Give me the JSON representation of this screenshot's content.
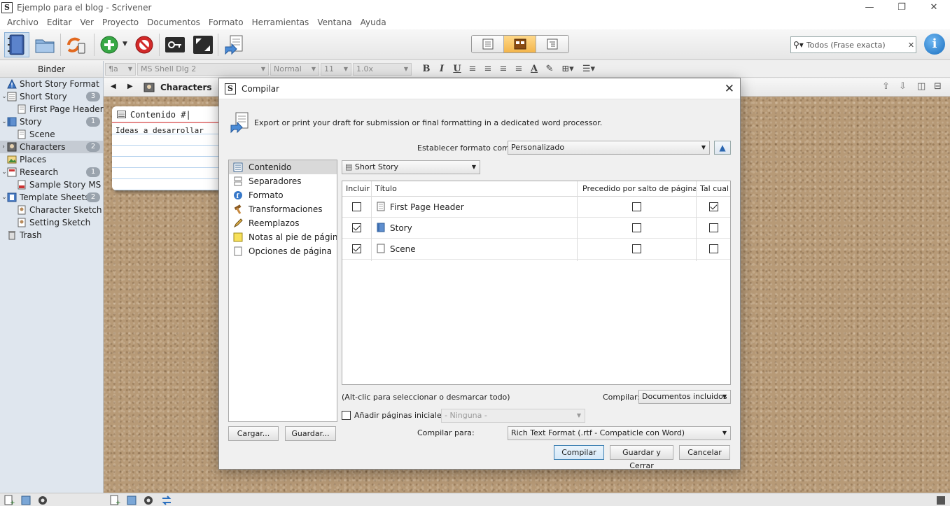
{
  "window": {
    "title": "Ejemplo para el blog - Scrivener",
    "minimize": "—",
    "maximize": "❐",
    "close": "✕"
  },
  "menu": [
    "Archivo",
    "Editar",
    "Ver",
    "Proyecto",
    "Documentos",
    "Formato",
    "Herramientas",
    "Ventana",
    "Ayuda"
  ],
  "search": {
    "value": "Todos (Frase exacta)",
    "clear": "✕"
  },
  "info_label": "i",
  "format_bar": {
    "style": "¶a",
    "font": "MS Shell Dlg 2",
    "weight": "Normal",
    "size": "11",
    "spacing": "1.0x",
    "bold": "B",
    "italic": "I",
    "underline": "U"
  },
  "binder": {
    "header": "Binder",
    "items": [
      {
        "label": "Short Story Format",
        "level": 0,
        "icon": "warning-icon"
      },
      {
        "label": "Short Story",
        "level": 0,
        "badge": "3",
        "expanded": true,
        "icon": "draft-folder-icon"
      },
      {
        "label": "First Page Header",
        "level": 1,
        "icon": "document-icon"
      },
      {
        "label": "Story",
        "level": 0,
        "badge": "1",
        "expanded": true,
        "icon": "folder-icon"
      },
      {
        "label": "Scene",
        "level": 1,
        "icon": "document-icon"
      },
      {
        "label": "Characters",
        "level": 0,
        "badge": "2",
        "collapsed": true,
        "selected": true,
        "icon": "characters-icon"
      },
      {
        "label": "Places",
        "level": 0,
        "icon": "places-icon"
      },
      {
        "label": "Research",
        "level": 0,
        "badge": "1",
        "expanded": true,
        "icon": "research-icon"
      },
      {
        "label": "Sample Story MS",
        "level": 1,
        "icon": "pdf-icon"
      },
      {
        "label": "Template Sheets",
        "level": 0,
        "badge": "2",
        "expanded": true,
        "icon": "template-icon"
      },
      {
        "label": "Character Sketch",
        "level": 1,
        "icon": "sheet-icon"
      },
      {
        "label": "Setting Sketch",
        "level": 1,
        "icon": "sheet-icon"
      },
      {
        "label": "Trash",
        "level": 0,
        "icon": "trash-icon"
      }
    ]
  },
  "editor": {
    "title": "Characters"
  },
  "card": {
    "title": "Contenido #|",
    "body": "Ideas a desarrollar"
  },
  "dialog": {
    "title": "Compilar",
    "description": "Export or print your draft for submission or final formatting in a dedicated word processor.",
    "format_label": "Establecer formato como:",
    "format_value": "Personalizado",
    "content_dropdown": "Short Story",
    "nav": [
      "Contenido",
      "Separadores",
      "Formato",
      "Transformaciones",
      "Reemplazos",
      "Notas al pie de página",
      "Opciones de página"
    ],
    "columns": {
      "include": "Incluir",
      "title": "Título",
      "page_break": "Precedido por salto de página",
      "as_is": "Tal cual"
    },
    "rows": [
      {
        "title": "First Page Header",
        "include": false,
        "page_break": false,
        "as_is": true
      },
      {
        "title": "Story",
        "include": true,
        "page_break": false,
        "as_is": false
      },
      {
        "title": "Scene",
        "include": true,
        "page_break": false,
        "as_is": false
      }
    ],
    "alt_hint": "(Alt-clic para seleccionar o desmarcar todo)",
    "compile_label": "Compilar:",
    "compile_value": "Documentos incluidos",
    "add_pages_label": "Añadir páginas iniciales:",
    "add_pages_value": "- Ninguna -",
    "compile_for_label": "Compilar para:",
    "compile_for_value": "Rich Text Format (.rtf - Compaticle con Word)",
    "load": "Cargar...",
    "save": "Guardar...",
    "compile_btn": "Compilar",
    "save_close_btn": "Guardar  y Cerrar",
    "cancel_btn": "Cancelar"
  }
}
